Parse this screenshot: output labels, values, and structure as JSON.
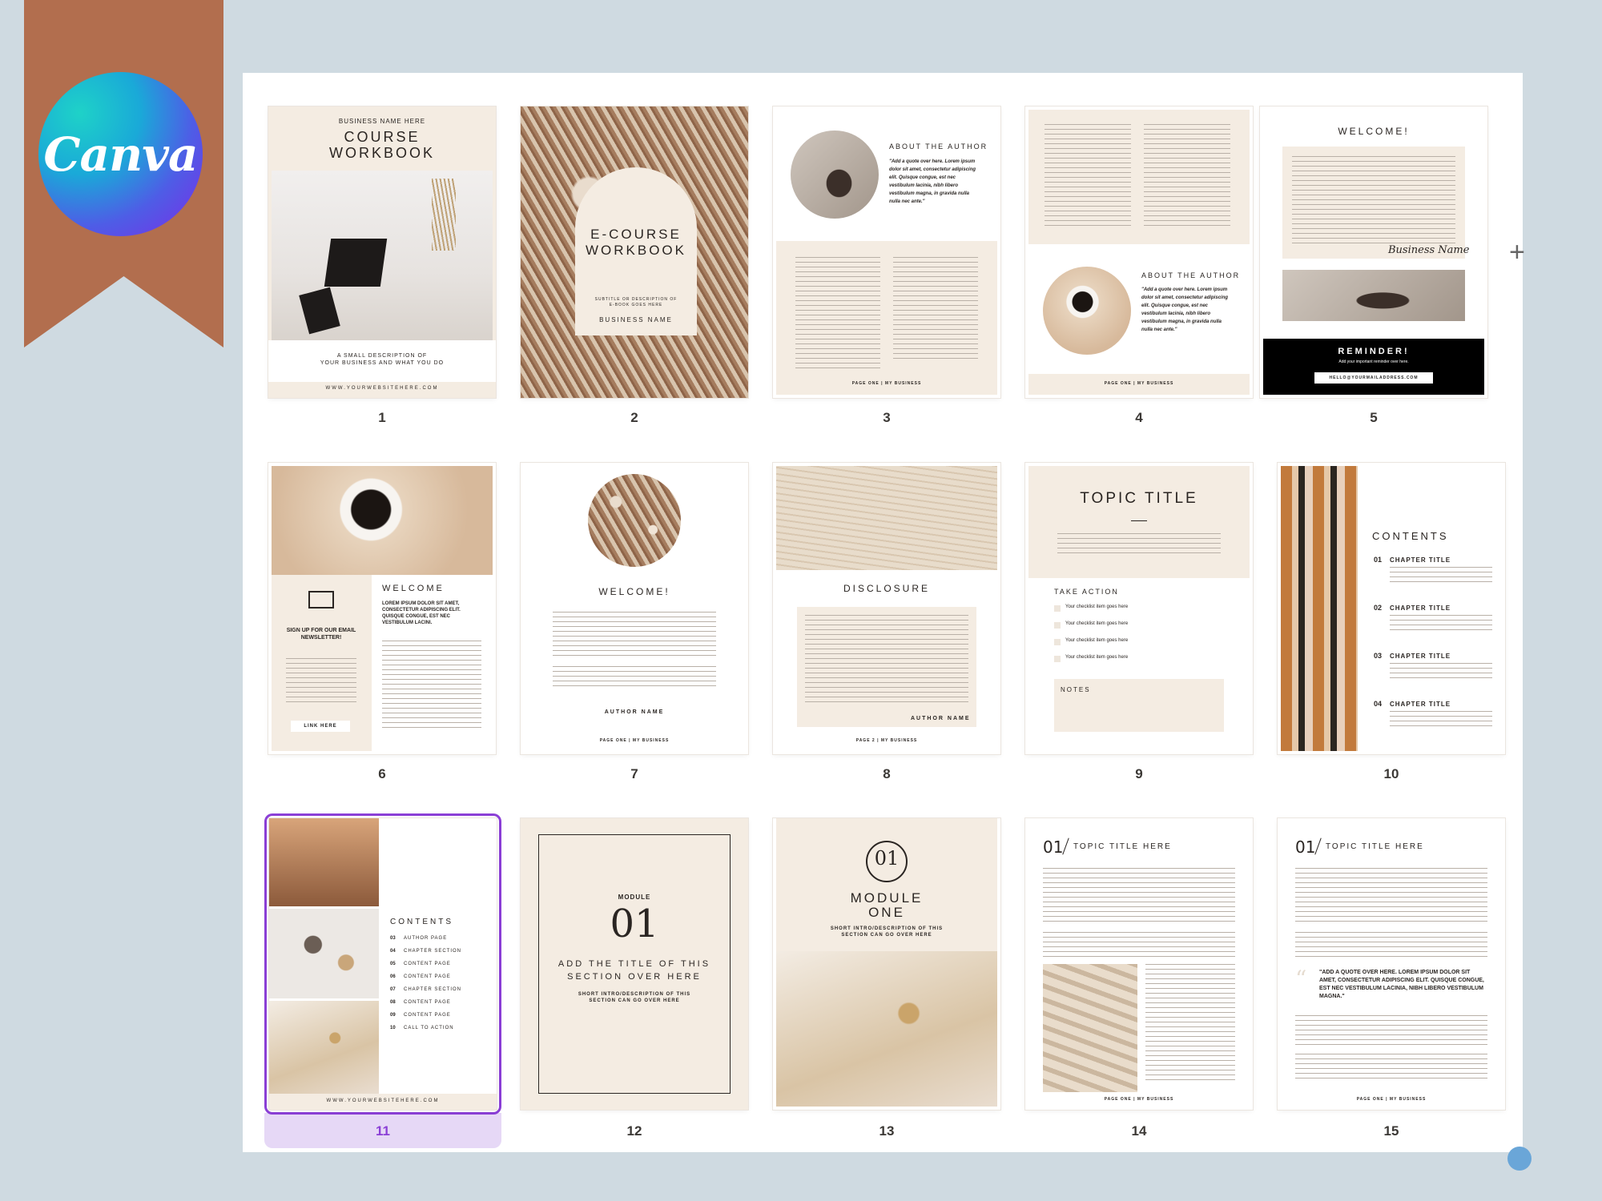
{
  "brand": {
    "logo_text": "Canva",
    "logo_colors": [
      "#1ed2c8",
      "#4e5de6",
      "#7c2ae8"
    ],
    "ribbon_color": "#b26e4e"
  },
  "selection_color": "#8b3fd6",
  "pages": [
    {
      "number": "1",
      "business": "BUSINESS NAME HERE",
      "title_line1": "COURSE",
      "title_line2": "WORKBOOK",
      "desc1": "A SMALL DESCRIPTION OF",
      "desc2": "YOUR BUSINESS AND WHAT YOU DO",
      "website": "WWW.YOURWEBSITEHERE.COM"
    },
    {
      "number": "2",
      "title_line1": "E-COURSE",
      "title_line2": "WORKBOOK",
      "subtitle": "SUBTITLE OR DESCRIPTION OF E-BOOK GOES HERE",
      "business": "BUSINESS NAME"
    },
    {
      "number": "3",
      "heading": "ABOUT THE AUTHOR",
      "quote": "\"Add a quote over here. Lorem ipsum dolor sit amet, consectetur adipiscing elit. Quisque congue, est nec vestibulum lacinia, nibh libero vestibulum magna, in gravida nulla nulla nec ante.\"",
      "footer": "PAGE ONE | MY BUSINESS"
    },
    {
      "number": "4",
      "heading": "ABOUT THE AUTHOR",
      "quote": "\"Add a quote over here. Lorem ipsum dolor sit amet, consectetur adipiscing elit. Quisque congue, est nec vestibulum lacinia, nibh libero vestibulum magna, in gravida nulla nulla nec ante.\"",
      "footer": "PAGE ONE | MY BUSINESS"
    },
    {
      "number": "5",
      "heading": "WELCOME!",
      "signature": "Business Name",
      "reminder": "REMINDER!",
      "reminder_sub": "Add your important reminder over here.",
      "email": "HELLO@YOURMAILADDRESS.COM"
    },
    {
      "number": "6",
      "heading": "WELCOME",
      "intro": "LOREM IPSUM DOLOR SIT AMET, CONSECTETUR ADIPISCING ELIT. QUISQUE CONGUE, EST NEC VESTIBULUM LACINI.",
      "signup": "SIGN UP FOR OUR EMAIL NEWSLETTER!",
      "link": "LINK HERE"
    },
    {
      "number": "7",
      "heading": "WELCOME!",
      "author": "AUTHOR NAME",
      "footer": "PAGE ONE | MY BUSINESS"
    },
    {
      "number": "8",
      "heading": "DISCLOSURE",
      "author": "AUTHOR NAME",
      "footer": "PAGE 2 | MY BUSINESS"
    },
    {
      "number": "9",
      "heading": "TOPIC TITLE",
      "take_action": "TAKE ACTION",
      "checklist": [
        "Your checklist item goes here",
        "Your checklist item goes here",
        "Your checklist item goes here",
        "Your checklist item goes here"
      ],
      "notes": "NOTES"
    },
    {
      "number": "10",
      "heading": "CONTENTS",
      "chapters": [
        {
          "num": "01",
          "title": "CHAPTER TITLE"
        },
        {
          "num": "02",
          "title": "CHAPTER TITLE"
        },
        {
          "num": "03",
          "title": "CHAPTER TITLE"
        },
        {
          "num": "04",
          "title": "CHAPTER TITLE"
        }
      ]
    },
    {
      "number": "11",
      "heading": "CONTENTS",
      "items": [
        {
          "num": "03",
          "label": "AUTHOR PAGE"
        },
        {
          "num": "04",
          "label": "CHAPTER SECTION"
        },
        {
          "num": "05",
          "label": "CONTENT PAGE"
        },
        {
          "num": "06",
          "label": "CONTENT PAGE"
        },
        {
          "num": "07",
          "label": "CHAPTER SECTION"
        },
        {
          "num": "08",
          "label": "CONTENT PAGE"
        },
        {
          "num": "09",
          "label": "CONTENT PAGE"
        },
        {
          "num": "10",
          "label": "CALL TO ACTION"
        }
      ],
      "website": "WWW.YOURWEBSITEHERE.COM",
      "selected": true
    },
    {
      "number": "12",
      "module": "MODULE",
      "module_num": "01",
      "title": "ADD THE TITLE OF THIS SECTION OVER HERE",
      "sub": "SHORT INTRO/DESCRIPTION OF THIS SECTION CAN GO OVER HERE"
    },
    {
      "number": "13",
      "badge": "01",
      "title_line1": "MODULE",
      "title_line2": "ONE",
      "sub": "SHORT INTRO/DESCRIPTION OF THIS SECTION CAN GO OVER HERE"
    },
    {
      "number": "14",
      "num": "01",
      "heading": "TOPIC TITLE HERE",
      "footer": "PAGE ONE | MY BUSINESS"
    },
    {
      "number": "15",
      "num": "01",
      "heading": "TOPIC TITLE HERE",
      "quote": "\"ADD A QUOTE OVER HERE. LOREM IPSUM DOLOR SIT AMET, CONSECTETUR ADIPISCING ELIT. QUISQUE CONGUE, EST NEC VESTIBULUM LACINIA, NIBH LIBERO VESTIBULUM MAGNA.\"",
      "footer": "PAGE ONE | MY BUSINESS"
    }
  ]
}
